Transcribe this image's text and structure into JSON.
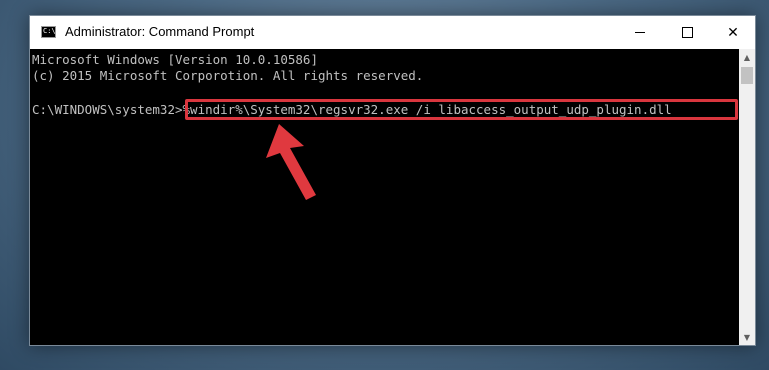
{
  "window": {
    "title": "Administrator: Command Prompt",
    "icon": "cmd-icon",
    "icon_text": "C:\\",
    "controls": {
      "minimize": "minimize-icon",
      "maximize": "maximize-icon",
      "close": "✕"
    }
  },
  "console": {
    "lines": [
      "Microsoft Windows [Version 10.0.10586]",
      "(c) 2015 Microsoft Corporotion. All rights reserved."
    ],
    "prompt": "C:\\WINDOWS\\system32>",
    "command": "%windir%\\System32\\regsvr32.exe /i libaccess_output_udp_plugin.dll"
  },
  "annotation": {
    "highlight_color": "#d9363e",
    "arrow_color": "#e0393f"
  },
  "scrollbar": {
    "up": "▲",
    "down": "▼"
  }
}
